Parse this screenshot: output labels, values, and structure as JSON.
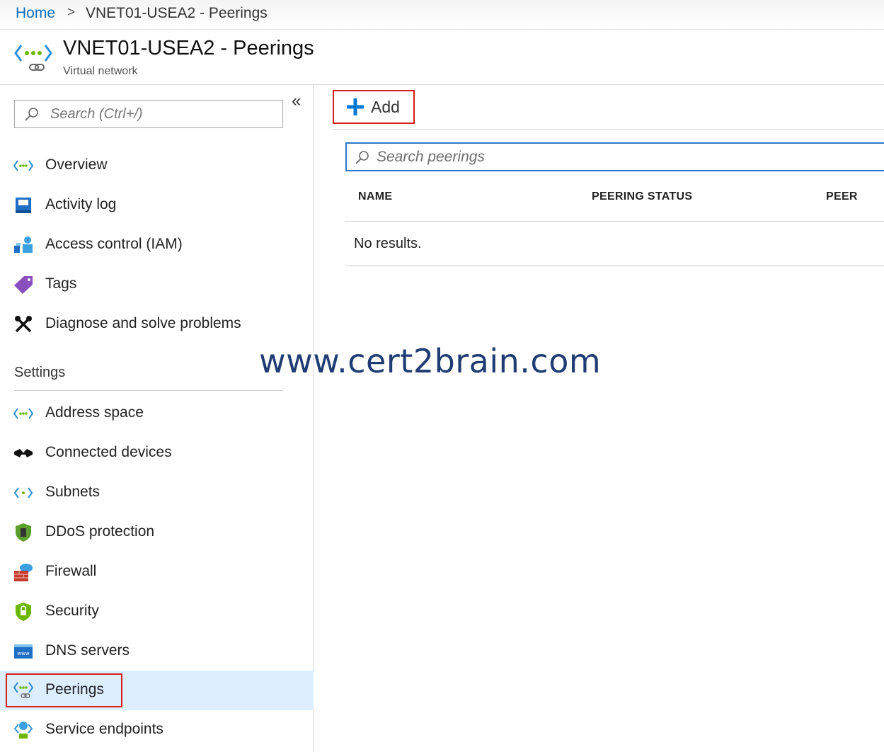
{
  "breadcrumb": {
    "home": "Home",
    "separator": ">",
    "current": "VNET01-USEA2 - Peerings"
  },
  "header": {
    "title": "VNET01-USEA2 - Peerings",
    "subtitle": "Virtual network",
    "icon": "vnet-peering-icon"
  },
  "sidebar": {
    "collapse_glyph": "«",
    "search_placeholder": "Search (Ctrl+/)",
    "items": [
      {
        "label": "Overview",
        "icon": "vnet-icon"
      },
      {
        "label": "Activity log",
        "icon": "activity-log-icon"
      },
      {
        "label": "Access control (IAM)",
        "icon": "iam-icon"
      },
      {
        "label": "Tags",
        "icon": "tag-icon"
      },
      {
        "label": "Diagnose and solve problems",
        "icon": "wrench-icon"
      }
    ],
    "settings_header": "Settings",
    "settings_items": [
      {
        "label": "Address space",
        "icon": "vnet-icon"
      },
      {
        "label": "Connected devices",
        "icon": "connected-devices-icon"
      },
      {
        "label": "Subnets",
        "icon": "subnet-icon"
      },
      {
        "label": "DDoS protection",
        "icon": "shield-icon"
      },
      {
        "label": "Firewall",
        "icon": "firewall-icon"
      },
      {
        "label": "Security",
        "icon": "security-shield-icon"
      },
      {
        "label": "DNS servers",
        "icon": "dns-icon"
      },
      {
        "label": "Peerings",
        "icon": "peering-icon",
        "selected": true
      },
      {
        "label": "Service endpoints",
        "icon": "service-endpoint-icon"
      }
    ]
  },
  "toolbar": {
    "add_label": "Add"
  },
  "peerings": {
    "search_placeholder": "Search peerings",
    "columns": [
      "NAME",
      "PEERING STATUS",
      "PEER"
    ],
    "empty_text": "No results."
  },
  "watermark": "www.cert2brain.com",
  "colors": {
    "link": "#0a6fc2",
    "accent": "#0078d4",
    "highlight": "#d61f1f",
    "selected_bg": "#ddeeff",
    "watermark": "#1f3d74"
  }
}
